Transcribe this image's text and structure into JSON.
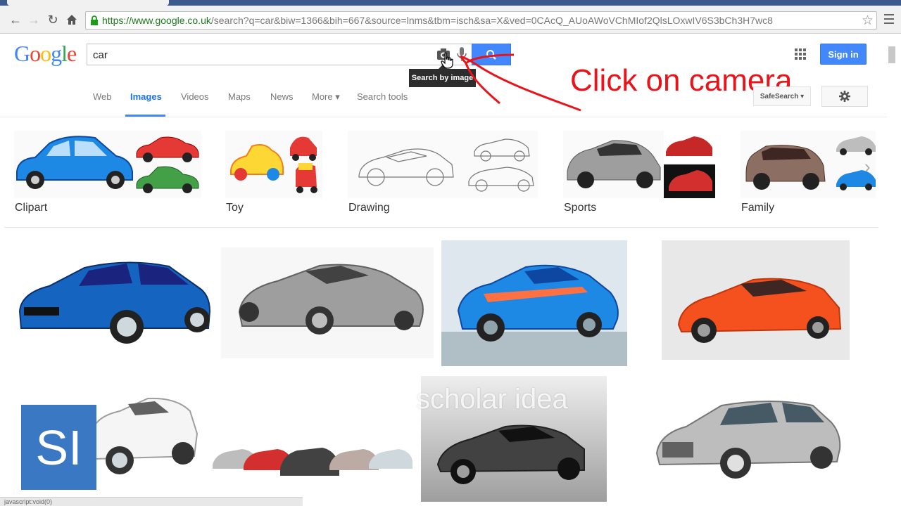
{
  "browser": {
    "url_host": "https://www.google.co.uk",
    "url_rest": "/search?q=car&biw=1366&bih=667&source=lnms&tbm=isch&sa=X&ved=0CAcQ_AUoAWoVChMIof2QlsLOxwIV6S3bCh3H7wc8",
    "back_icon": "arrow-left",
    "forward_icon": "arrow-right",
    "reload_icon": "reload",
    "home_icon": "home",
    "star_icon": "star"
  },
  "google": {
    "logo_letters": [
      {
        "ch": "G",
        "color": "#4285f4"
      },
      {
        "ch": "o",
        "color": "#ea4335"
      },
      {
        "ch": "o",
        "color": "#fbbc05"
      },
      {
        "ch": "g",
        "color": "#4285f4"
      },
      {
        "ch": "l",
        "color": "#34a853"
      },
      {
        "ch": "e",
        "color": "#ea4335"
      }
    ],
    "query": "car",
    "tooltip": "Search by image",
    "sign_in": "Sign in",
    "accent": "#4387fd"
  },
  "annotation": {
    "text": "Click on camera",
    "color": "#e8141a"
  },
  "nav": {
    "tabs": [
      "Web",
      "Images",
      "Videos",
      "Maps",
      "News",
      "More ▾",
      "Search tools"
    ],
    "active": "Images",
    "safesearch": "SafeSearch ▾"
  },
  "categories": [
    {
      "label": "Clipart",
      "colors": [
        "#1e88e5",
        "#e53935",
        "#43a047"
      ]
    },
    {
      "label": "Toy",
      "colors": [
        "#fdd835",
        "#e53935",
        "#1e88e5"
      ]
    },
    {
      "label": "Drawing",
      "colors": [
        "#9e9e9e",
        "#bdbdbd",
        "#9e9e9e"
      ]
    },
    {
      "label": "Sports",
      "colors": [
        "#9e9e9e",
        "#c62828",
        "#d32f2f"
      ]
    },
    {
      "label": "Family",
      "colors": [
        "#8d6e63",
        "#bdbdbd",
        "#1e88e5"
      ]
    }
  ],
  "results": [
    {
      "name": "blue-sedan",
      "body": "#1565c0"
    },
    {
      "name": "silver-concept",
      "body": "#9e9e9e"
    },
    {
      "name": "blue-sports-car",
      "body": "#1e88e5"
    },
    {
      "name": "orange-lamborghini",
      "body": "#f4511e"
    },
    {
      "name": "white-coupe",
      "body": "#f5f5f5"
    },
    {
      "name": "car-lineup",
      "body": "#b0b0b0"
    },
    {
      "name": "dark-nsx",
      "body": "#424242"
    },
    {
      "name": "silver-sedan",
      "body": "#bdbdbd"
    }
  ],
  "watermark": {
    "text": "scholar idea",
    "logo": "SI"
  },
  "status": "javascript:void(0)"
}
